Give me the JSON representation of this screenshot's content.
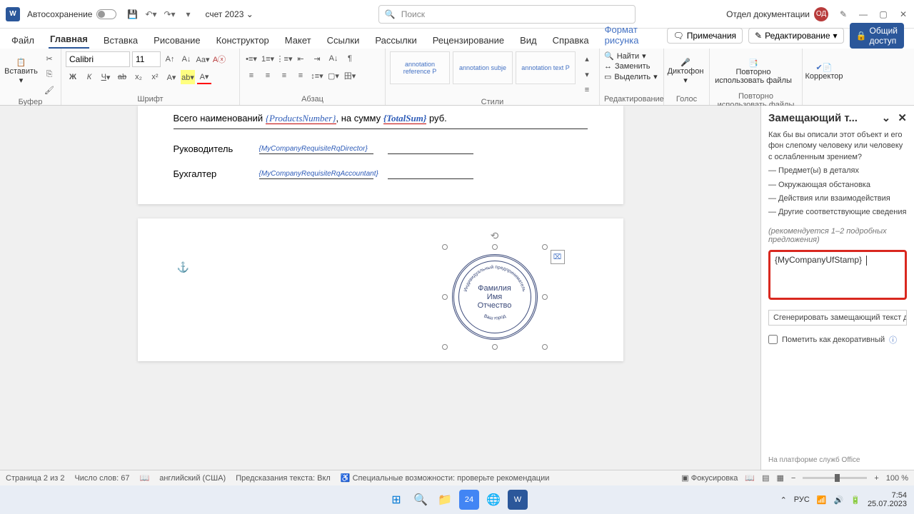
{
  "titlebar": {
    "autosave": "Автосохранение",
    "doc_name": "счет 2023",
    "search_placeholder": "Поиск",
    "user_name": "Отдел документации",
    "user_initials": "ОД"
  },
  "tabs": {
    "file": "Файл",
    "home": "Главная",
    "insert": "Вставка",
    "draw": "Рисование",
    "design": "Конструктор",
    "layout": "Макет",
    "references": "Ссылки",
    "mailings": "Рассылки",
    "review": "Рецензирование",
    "view": "Вид",
    "help": "Справка",
    "format": "Формат рисунка",
    "comments": "Примечания",
    "editing": "Редактирование",
    "share": "Общий доступ"
  },
  "ribbon": {
    "paste": "Вставить",
    "clipboard": "Буфер обмена",
    "font_name": "Calibri",
    "font_size": "11",
    "font_group": "Шрифт",
    "para_group": "Абзац",
    "style1": "annotation reference P",
    "style2": "annotation subje",
    "style3": "annotation text P",
    "styles_group": "Стили",
    "find": "Найти",
    "replace": "Заменить",
    "select": "Выделить",
    "editing_group": "Редактирование",
    "dictate": "Диктофон",
    "voice_group": "Голос",
    "reuse": "Повторно использовать файлы",
    "reuse_group": "Повторно использовать файлы",
    "corrector": "Корректор"
  },
  "doc": {
    "total_line_1": "Всего наименований ",
    "products_ph": "{ProductsNumber}",
    "total_line_2": ", на сумму ",
    "total_ph": "{TotalSum}",
    "total_line_3": "  руб.",
    "director_label": "Руководитель",
    "director_ph": "{MyCompanyRequisiteRqDirector}",
    "accountant_label": "Бухгалтер",
    "accountant_ph": "{MyCompanyRequisiteRqAccountant}",
    "stamp_top": "Индивидуальный предприниматель",
    "stamp_l1": "Фамилия",
    "stamp_l2": "Имя",
    "stamp_l3": "Отчество",
    "stamp_bottom": "Ваш город"
  },
  "panel": {
    "title": "Замещающий т...",
    "q": "Как бы вы описали этот объект и его фон слепому человеку или человеку с ослабленным зрением?",
    "b1": "— Предмет(ы) в деталях",
    "b2": "— Окружающая обстановка",
    "b3": "— Действия или взаимодействия",
    "b4": "— Другие соответствующие сведения",
    "hint": "(рекомендуется 1–2 подробных предложения)",
    "alt_value": "{MyCompanyUfStamp}",
    "gen": "Сгенерировать замещающий текст для ме",
    "decorative": "Пометить как декоративный",
    "footer": "На платформе служб Office"
  },
  "status": {
    "page": "Страница 2 из 2",
    "words": "Число слов: 67",
    "lang": "английский (США)",
    "predict": "Предсказания текста: Вкл",
    "a11y": "Специальные возможности: проверьте рекомендации",
    "focus": "Фокусировка",
    "zoom": "100 %"
  },
  "tray": {
    "lang": "РУС",
    "date": "25.07.2023",
    "time": "7:54"
  }
}
